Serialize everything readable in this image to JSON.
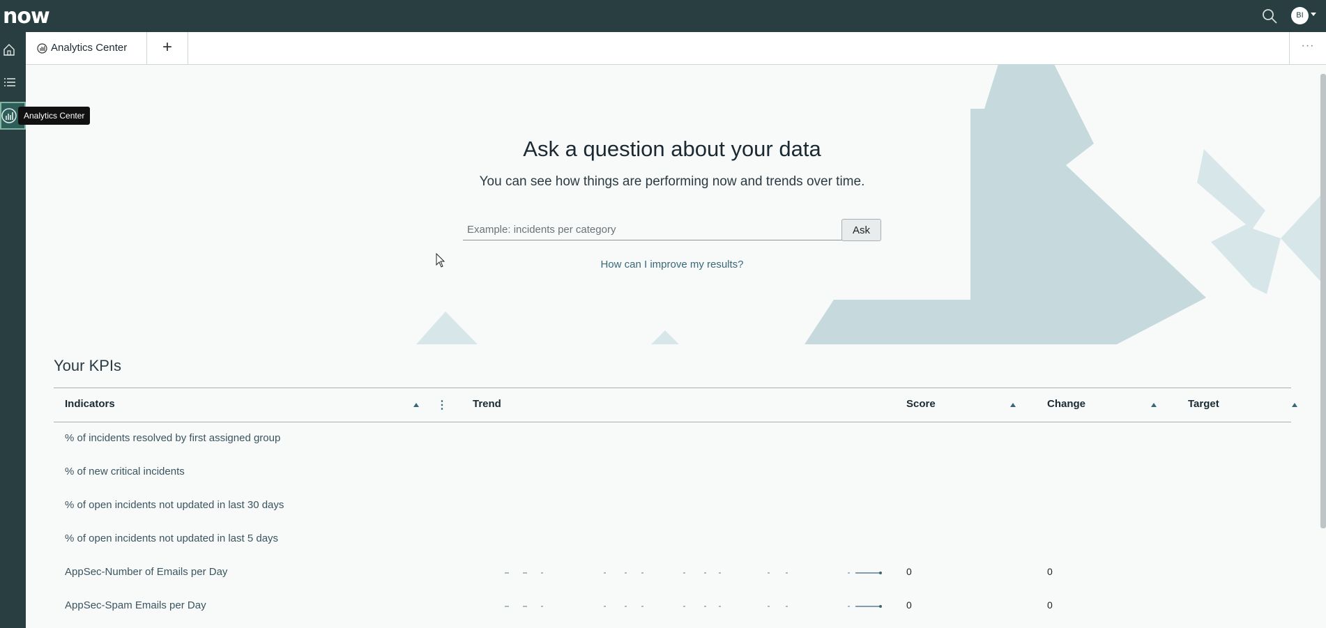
{
  "app": {
    "logo_text": "now",
    "user_initials": "BI"
  },
  "sidebar": {
    "items": [
      {
        "icon": "home-icon"
      },
      {
        "icon": "list-icon"
      },
      {
        "icon": "analytics-icon",
        "tooltip": "Analytics Center",
        "active": true
      }
    ]
  },
  "tabs": [
    {
      "label": "Analytics Center",
      "icon": "analytics-icon"
    }
  ],
  "tab_add_label": "+",
  "tab_more_label": "···",
  "hero": {
    "title": "Ask a question about your data",
    "subtitle": "You can see how things are performing now and trends over time.",
    "input_placeholder": "Example: incidents per category",
    "input_value": "",
    "ask_label": "Ask",
    "improve_link": "How can I improve my results?"
  },
  "kpis": {
    "title": "Your KPIs",
    "columns": [
      "Indicators",
      "Trend",
      "Score",
      "Change",
      "Target"
    ],
    "rows": [
      {
        "name": "% of incidents resolved by first assigned group",
        "score": "",
        "change": "",
        "trend": false
      },
      {
        "name": "% of new critical incidents",
        "score": "",
        "change": "",
        "trend": false
      },
      {
        "name": "% of open incidents not updated in last 30 days",
        "score": "",
        "change": "",
        "trend": false
      },
      {
        "name": "% of open incidents not updated in last 5 days",
        "score": "",
        "change": "",
        "trend": false
      },
      {
        "name": "AppSec-Number of Emails per Day",
        "score": "0",
        "change": "0",
        "trend": true
      },
      {
        "name": "AppSec-Spam Emails per Day",
        "score": "0",
        "change": "0",
        "trend": true
      }
    ]
  },
  "colors": {
    "header_bg": "#293e40",
    "accent": "#81b5a1",
    "link": "#3a6776",
    "hero_shape": "#c8dcdf"
  }
}
